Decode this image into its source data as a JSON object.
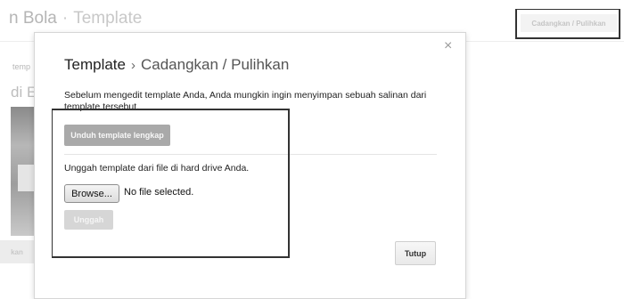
{
  "background": {
    "title_prefix": "n Bola",
    "title_separator": "·",
    "title_page": "Template",
    "top_button": "Cadangkan / Pulihkan",
    "left_text_small": "temp",
    "left_text_large": "di E",
    "left_button": "kan"
  },
  "dialog": {
    "title": "Template",
    "breadcrumb_separator": "›",
    "breadcrumb": "Cadangkan / Pulihkan",
    "close_icon": "×",
    "description": "Sebelum mengedit template Anda, Anda mungkin ingin menyimpan sebuah salinan dari template tersebut.",
    "download_button": "Unduh template lengkap",
    "upload_text": "Unggah template dari file di hard drive Anda.",
    "browse_button": "Browse...",
    "file_status": "No file selected.",
    "upload_button": "Unggah",
    "close_button": "Tutup"
  },
  "colors": {
    "disabled_button": "#d6d6d6",
    "download_button": "#a9a9a9"
  }
}
